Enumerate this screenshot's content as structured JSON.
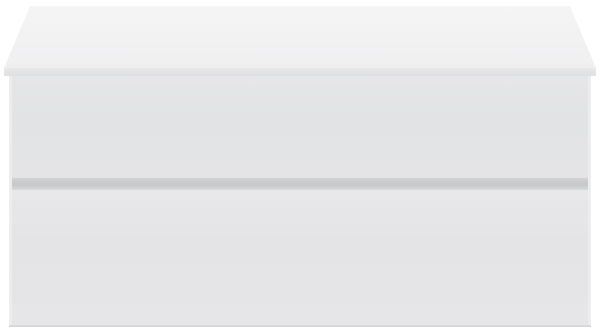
{
  "image": {
    "subject": "",
    "colors": {
      "background": "#ffffff",
      "top_surface": "#f3f3f4",
      "front_panel": "#e4e4e6",
      "drawer_gap": "#c8c9cb"
    }
  }
}
